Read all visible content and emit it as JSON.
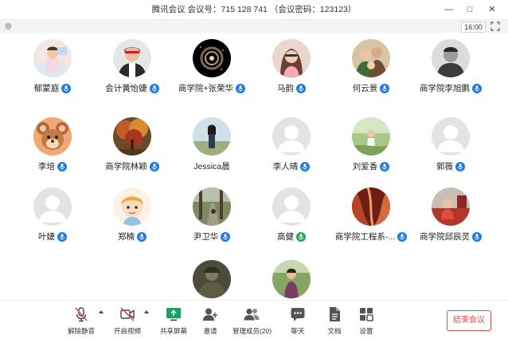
{
  "window": {
    "title": "腾讯会议 会议号：715 128 741 （会议密码：123123）",
    "minimize_glyph": "—",
    "maximize_glyph": "□",
    "close_glyph": "✕"
  },
  "subbar": {
    "time": "16:00"
  },
  "participants": [
    {
      "name": "郁蒙庭",
      "avatar": "photo-child",
      "mic": "on"
    },
    {
      "name": "会计黄怡婕",
      "avatar": "photo-hockey",
      "mic": "on"
    },
    {
      "name": "商学院+张荣华",
      "avatar": "photo-galaxy",
      "mic": "on"
    },
    {
      "name": "马韵",
      "avatar": "photo-woman",
      "mic": "on"
    },
    {
      "name": "何云景",
      "avatar": "photo-family",
      "mic": "on"
    },
    {
      "name": "商学院李旭鹏",
      "avatar": "photo-man-bw",
      "mic": "on"
    },
    {
      "name": "李培",
      "avatar": "photo-cartoon-mouse",
      "mic": "on"
    },
    {
      "name": "商学院林颖",
      "avatar": "photo-autumn-tree",
      "mic": "on"
    },
    {
      "name": "Jessica晨",
      "avatar": "photo-girl-outdoor",
      "mic": "none"
    },
    {
      "name": "李人晴",
      "avatar": "default",
      "mic": "on"
    },
    {
      "name": "刘爱香",
      "avatar": "photo-green-field",
      "mic": "on"
    },
    {
      "name": "郭薇",
      "avatar": "default",
      "mic": "on"
    },
    {
      "name": "叶婕",
      "avatar": "default",
      "mic": "on"
    },
    {
      "name": "郑楠",
      "avatar": "photo-cartoon-girl",
      "mic": "on"
    },
    {
      "name": "尹卫华",
      "avatar": "photo-forest-path",
      "mic": "on"
    },
    {
      "name": "高健",
      "avatar": "default",
      "mic": "speaking"
    },
    {
      "name": "商学院工程系-...",
      "avatar": "photo-red-canyon",
      "mic": "on"
    },
    {
      "name": "商学院邱辰灵",
      "avatar": "photo-red-room",
      "mic": "on"
    },
    {
      "name": "",
      "avatar": "photo-soldier",
      "mic": "none"
    },
    {
      "name": "",
      "avatar": "photo-lady-garden",
      "mic": "none"
    }
  ],
  "toolbar": {
    "unmute": "解除静音",
    "start_video": "开启视频",
    "share_screen": "共享屏幕",
    "invite": "邀请",
    "manage_members": "管理成员(20)",
    "chat": "聊天",
    "documents": "文档",
    "settings": "设置",
    "end_meeting": "结束会议"
  },
  "colors": {
    "accent": "#1f7ae8",
    "speaking": "#2aa84a",
    "danger": "#e04b4b",
    "share": "#1aa260"
  }
}
